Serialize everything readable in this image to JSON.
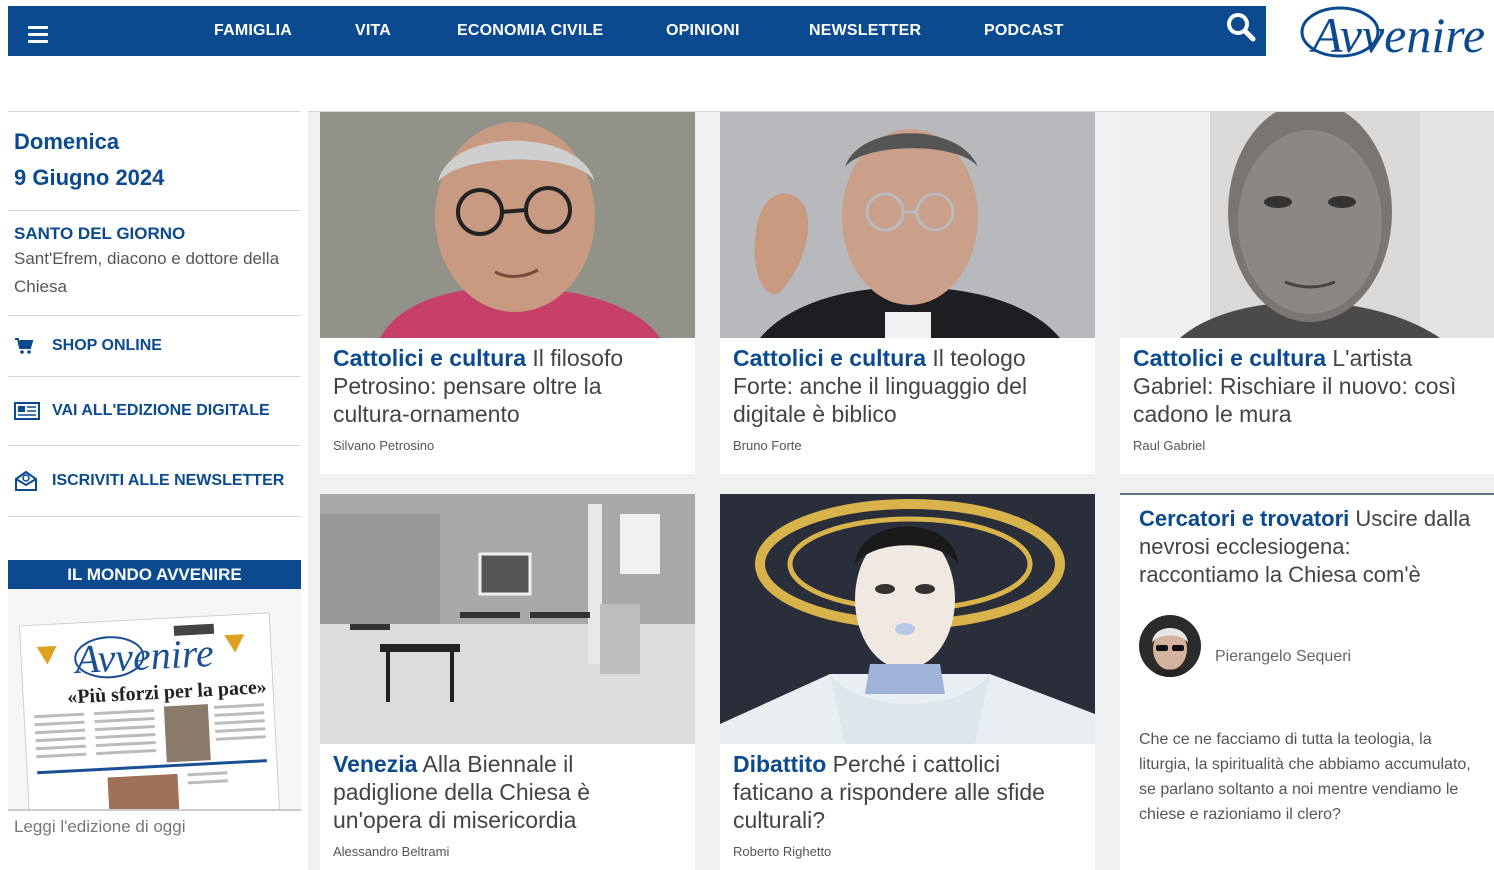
{
  "nav": {
    "items": [
      "FAMIGLIA",
      "VITA",
      "ECONOMIA CIVILE",
      "OPINIONI",
      "NEWSLETTER",
      "PODCAST"
    ],
    "menu_icon": "hamburger-icon",
    "search_icon": "search-icon"
  },
  "logo": {
    "text": "Avvenire"
  },
  "sidebar": {
    "day": "Domenica",
    "date": "9 Giugno 2024",
    "saint_title": "SANTO DEL GIORNO",
    "saint_text": "Sant'Efrem, diacono e dottore della Chiesa",
    "links": [
      {
        "label": "SHOP ONLINE",
        "icon": "cart-icon"
      },
      {
        "label": "VAI ALL'EDIZIONE DIGITALE",
        "icon": "newspaper-icon"
      },
      {
        "label": "ISCRIVITI ALLE NEWSLETTER",
        "icon": "envelope-icon"
      }
    ],
    "mondo_title": "IL MONDO AVVENIRE",
    "mondo_caption": "Leggi l'edizione di oggi",
    "cover_headline": "«Più sforzi per la pace»"
  },
  "articles": [
    {
      "kicker": "Cattolici e cultura",
      "title": "Il filosofo Petrosino: pensare oltre la cultura-ornamento",
      "author": "Silvano Petrosino"
    },
    {
      "kicker": "Cattolici e cultura",
      "title": "Il teologo Forte: anche il linguaggio del digitale è biblico",
      "author": "Bruno Forte"
    },
    {
      "kicker": "Cattolici e cultura",
      "title": "L'artista Gabriel: Rischiare il nuovo: così cadono le mura",
      "author": "Raul Gabriel"
    },
    {
      "kicker": "Venezia",
      "title": "Alla Biennale il padiglione della Chiesa è un'opera di misericordia",
      "author": "Alessandro Beltrami"
    },
    {
      "kicker": "Dibattito",
      "title": "Perché i cattolici faticano a rispondere alle sfide culturali?",
      "author": "Roberto Righetto"
    }
  ],
  "opinion": {
    "kicker": "Cercatori e trovatori",
    "title": "Uscire dalla nevrosi ecclesiogena: raccontiamo la Chiesa com'è",
    "author": "Pierangelo Sequeri",
    "excerpt": "Che ce ne facciamo di tutta la teologia, la liturgia, la spiritualità che abbiamo accumulato, se parlano soltanto a noi mentre vendiamo le chiese e razioniamo il clero?"
  },
  "colors": {
    "brand": "#0b4a8f",
    "grid_bg": "#f0f0f0"
  }
}
